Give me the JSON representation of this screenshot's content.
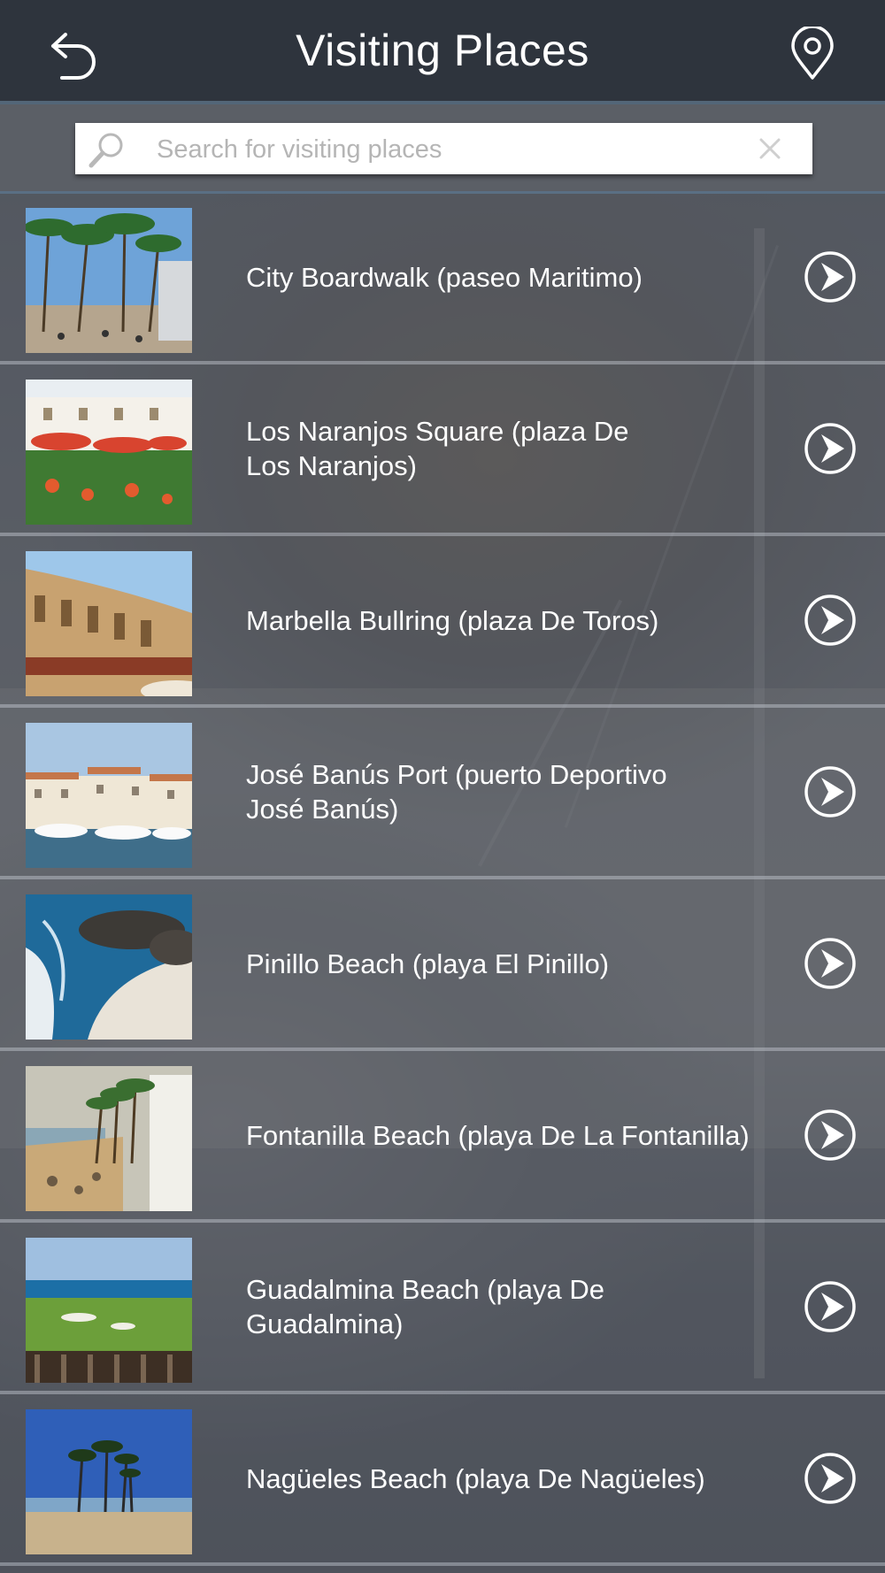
{
  "header": {
    "title": "Visiting Places",
    "back_icon": "back-arrow-icon",
    "location_icon": "map-pin-icon"
  },
  "search": {
    "placeholder": "Search for visiting places",
    "value": ""
  },
  "places": [
    {
      "label": "City Boardwalk (paseo Maritimo)"
    },
    {
      "label": "Los Naranjos Square (plaza De Los Naranjos)"
    },
    {
      "label": "Marbella Bullring (plaza De Toros)"
    },
    {
      "label": "José Banús Port (puerto Deportivo José Banús)"
    },
    {
      "label": "Pinillo Beach (playa El Pinillo)"
    },
    {
      "label": "Fontanilla Beach (playa De La Fontanilla)"
    },
    {
      "label": "Guadalmina Beach (playa De Guadalmina)"
    },
    {
      "label": "Nagüeles Beach (playa De Nagüeles)"
    }
  ],
  "colors": {
    "header_bg": "#2e343d",
    "accent_line": "#536678",
    "text": "#ffffff"
  }
}
